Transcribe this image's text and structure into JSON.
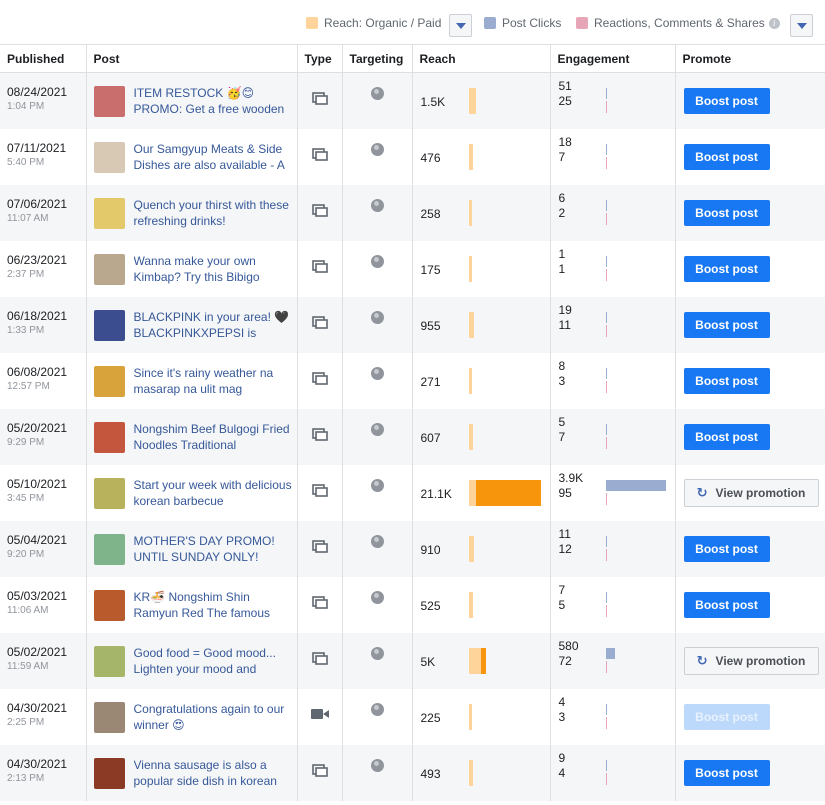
{
  "legend": {
    "reach_label": "Reach: Organic / Paid",
    "clicks_label": "Post Clicks",
    "reactions_label": "Reactions, Comments & Shares",
    "colors": {
      "organic": "#ffd49a",
      "paid": "#f7960c",
      "clicks": "#9aaccf",
      "reactions": "#e6a6b8"
    }
  },
  "columns": [
    "Published",
    "Post",
    "Type",
    "Targeting",
    "Reach",
    "Engagement",
    "Promote"
  ],
  "rows": [
    {
      "date": "08/24/2021",
      "time": "1:04 PM",
      "text": "ITEM RESTOCK 🥳😊 PROMO: Get a free wooden",
      "type": "post-icon",
      "reach": "1.5K",
      "reach_organic": 1500,
      "reach_paid": 0,
      "eng1": "51",
      "eng2": "25",
      "eng1_value": 51,
      "action": "Boost post",
      "action_type": "boost",
      "thumb": "#c96d6d"
    },
    {
      "date": "07/11/2021",
      "time": "5:40 PM",
      "text": "Our Samgyup Meats & Side Dishes are also available - A",
      "type": "post-icon",
      "reach": "476",
      "reach_organic": 476,
      "reach_paid": 0,
      "eng1": "18",
      "eng2": "7",
      "eng1_value": 18,
      "action": "Boost post",
      "action_type": "boost",
      "thumb": "#d8c9b4"
    },
    {
      "date": "07/06/2021",
      "time": "11:07 AM",
      "text": "Quench your thirst with these refreshing drinks!",
      "type": "post-icon",
      "reach": "258",
      "reach_organic": 258,
      "reach_paid": 0,
      "eng1": "6",
      "eng2": "2",
      "eng1_value": 6,
      "action": "Boost post",
      "action_type": "boost",
      "thumb": "#e3c96a"
    },
    {
      "date": "06/23/2021",
      "time": "2:37 PM",
      "text": "Wanna make your own Kimbap? Try this Bibigo",
      "type": "post-icon",
      "reach": "175",
      "reach_organic": 175,
      "reach_paid": 0,
      "eng1": "1",
      "eng2": "1",
      "eng1_value": 1,
      "action": "Boost post",
      "action_type": "boost",
      "thumb": "#b9a88e"
    },
    {
      "date": "06/18/2021",
      "time": "1:33 PM",
      "text": "BLACKPINK in your area! 🖤 BLACKPINKXPEPSI is",
      "type": "post-icon",
      "reach": "955",
      "reach_organic": 955,
      "reach_paid": 0,
      "eng1": "19",
      "eng2": "11",
      "eng1_value": 19,
      "action": "Boost post",
      "action_type": "boost",
      "thumb": "#3b4d8f"
    },
    {
      "date": "06/08/2021",
      "time": "12:57 PM",
      "text": "Since it's rainy weather na masarap na ulit mag",
      "type": "post-icon",
      "reach": "271",
      "reach_organic": 271,
      "reach_paid": 0,
      "eng1": "8",
      "eng2": "3",
      "eng1_value": 8,
      "action": "Boost post",
      "action_type": "boost",
      "thumb": "#d9a33b"
    },
    {
      "date": "05/20/2021",
      "time": "9:29 PM",
      "text": "Nongshim Beef Bulgogi Fried Noodles Traditional",
      "type": "post-icon",
      "reach": "607",
      "reach_organic": 607,
      "reach_paid": 0,
      "eng1": "5",
      "eng2": "7",
      "eng1_value": 5,
      "action": "Boost post",
      "action_type": "boost",
      "thumb": "#c4563d"
    },
    {
      "date": "05/10/2021",
      "time": "3:45 PM",
      "text": "Start your week with delicious korean barbecue",
      "type": "post-icon",
      "reach": "21.1K",
      "reach_organic": 2000,
      "reach_paid": 19100,
      "eng1": "3.9K",
      "eng2": "95",
      "eng1_value": 3900,
      "action": "View promotion",
      "action_type": "view",
      "thumb": "#b8b25c"
    },
    {
      "date": "05/04/2021",
      "time": "9:20 PM",
      "text": "MOTHER'S DAY PROMO! UNTIL SUNDAY ONLY!",
      "type": "post-icon",
      "reach": "910",
      "reach_organic": 910,
      "reach_paid": 0,
      "eng1": "11",
      "eng2": "12",
      "eng1_value": 11,
      "action": "Boost post",
      "action_type": "boost",
      "thumb": "#7fb38a"
    },
    {
      "date": "05/03/2021",
      "time": "11:06 AM",
      "text": "KR🍜 Nongshim Shin Ramyun Red The famous",
      "type": "post-icon",
      "reach": "525",
      "reach_organic": 525,
      "reach_paid": 0,
      "eng1": "7",
      "eng2": "5",
      "eng1_value": 7,
      "action": "Boost post",
      "action_type": "boost",
      "thumb": "#b85a2b"
    },
    {
      "date": "05/02/2021",
      "time": "11:59 AM",
      "text": "Good food = Good mood... Lighten your mood and",
      "type": "post-icon",
      "reach": "5K",
      "reach_organic": 3500,
      "reach_paid": 1500,
      "eng1": "580",
      "eng2": "72",
      "eng1_value": 580,
      "action": "View promotion",
      "action_type": "view",
      "thumb": "#a5b56a"
    },
    {
      "date": "04/30/2021",
      "time": "2:25 PM",
      "text": "Congratulations again to our winner 😍",
      "type": "video-icon",
      "reach": "225",
      "reach_organic": 225,
      "reach_paid": 0,
      "eng1": "4",
      "eng2": "3",
      "eng1_value": 4,
      "action": "Boost post",
      "action_type": "boost-disabled",
      "thumb": "#9a8874"
    },
    {
      "date": "04/30/2021",
      "time": "2:13 PM",
      "text": "Vienna sausage is also a popular side dish in korean",
      "type": "post-icon",
      "reach": "493",
      "reach_organic": 493,
      "reach_paid": 0,
      "eng1": "9",
      "eng2": "4",
      "eng1_value": 9,
      "action": "Boost post",
      "action_type": "boost",
      "thumb": "#8a3a25"
    }
  ]
}
